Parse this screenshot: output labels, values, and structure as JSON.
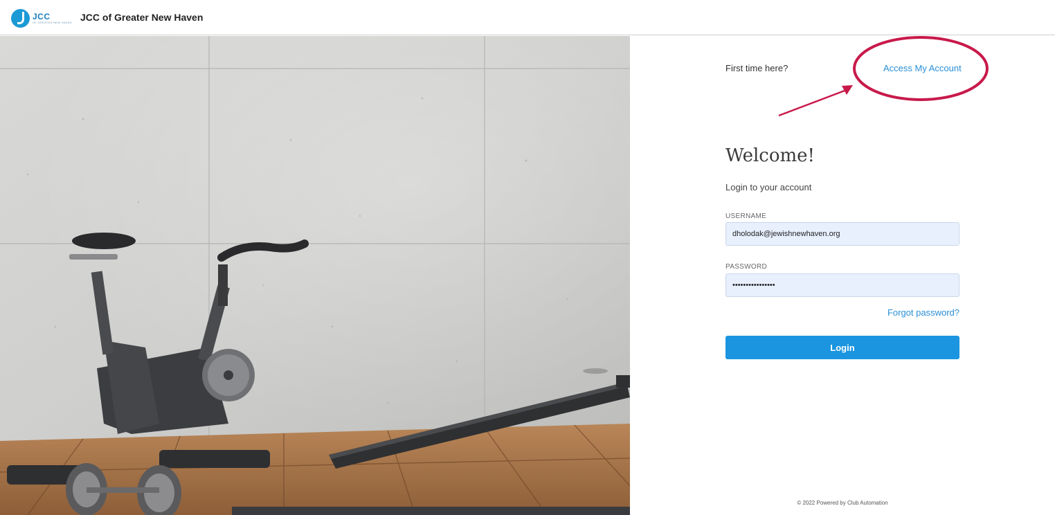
{
  "header": {
    "logo_text": "JCC",
    "logo_subtext": "OF GREATER NEW HAVEN",
    "org_name": "JCC of Greater New Haven"
  },
  "hero": {
    "image_description_icon": "fitness-equipment-photo"
  },
  "panel": {
    "first_time_text": "First time here?",
    "access_link": "Access My Account",
    "welcome_title": "Welcome!",
    "subtitle": "Login to your account",
    "username_label": "USERNAME",
    "username_value": "dholodak@jewishnewhaven.org",
    "password_label": "PASSWORD",
    "password_value": "••••••••••••••••",
    "forgot_link": "Forgot password?",
    "login_button": "Login",
    "footer": "© 2022 Powered by Club Automation"
  },
  "colors": {
    "accent": "#1b95e0",
    "link": "#2a8fd8",
    "annotation": "#c8194a",
    "field_bg": "#e8f0fe"
  }
}
